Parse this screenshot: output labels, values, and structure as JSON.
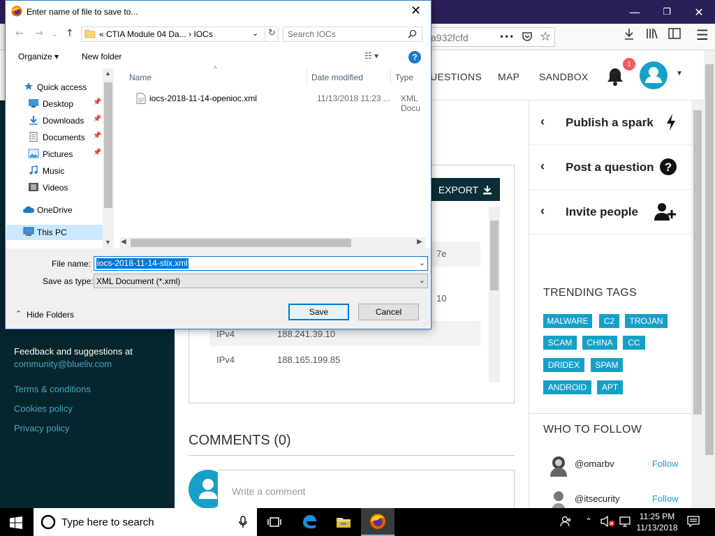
{
  "browser": {
    "url_fragment": "a932fcfd",
    "window_controls": {
      "minimize": "—",
      "restore": "❐",
      "close": "✕"
    },
    "toolbar_icons": [
      "more-dots-icon",
      "pocket-icon",
      "bookmark-star-icon",
      "download-icon",
      "library-icon",
      "sidebar-icon",
      "hamburger-menu-icon"
    ],
    "more_glyph": "•••",
    "star_glyph": "☆",
    "download_glyph": "⭳",
    "menu_glyph": "☰"
  },
  "site": {
    "nav": [
      "UESTIONS",
      "MAP",
      "SANDBOX"
    ],
    "notification_count": "1",
    "export_label": "EXPORT",
    "iocs": [
      {
        "type": "",
        "value": "7e"
      },
      {
        "type": "",
        "value": "10"
      },
      {
        "type": "IPv4",
        "value": "188.241.39.10"
      },
      {
        "type": "IPv4",
        "value": "188.165.199.85"
      }
    ],
    "comments_title": "COMMENTS (0)",
    "comment_placeholder": "Write a comment",
    "footer": {
      "feedback": "Feedback and suggestions at",
      "email": "community@blueliv.com",
      "links": [
        "Terms & conditions",
        "Cookies policy",
        "Privacy policy"
      ]
    },
    "actions": [
      {
        "label": "Publish a spark",
        "icon": "lightning-icon"
      },
      {
        "label": "Post a question",
        "icon": "question-circle-icon"
      },
      {
        "label": "Invite people",
        "icon": "add-user-icon"
      }
    ],
    "trending_title": "TRENDING TAGS",
    "tags": [
      "MALWARE",
      "C2",
      "TROJAN",
      "SCAM",
      "CHINA",
      "CC",
      "DRIDEX",
      "SPAM",
      "ANDROID",
      "APT"
    ],
    "who_to_follow_title": "WHO TO FOLLOW",
    "follow": [
      {
        "handle": "@omarbv",
        "button": "Follow"
      },
      {
        "handle": "@itsecurity",
        "button": "Follow"
      }
    ],
    "chevron": "‹"
  },
  "dialog": {
    "title": "Enter name of file to save to...",
    "address_path": "«  CTIA Module 04 Da...  ›  IOCs",
    "search_placeholder": "Search IOCs",
    "organize": "Organize ▾",
    "new_folder": "New folder",
    "help": "?",
    "nav_tree": [
      {
        "label": "Quick access",
        "icon": "star-icon",
        "pinned": false
      },
      {
        "label": "Desktop",
        "icon": "desktop-folder-icon",
        "pinned": true
      },
      {
        "label": "Downloads",
        "icon": "downloads-folder-icon",
        "pinned": true
      },
      {
        "label": "Documents",
        "icon": "documents-folder-icon",
        "pinned": true
      },
      {
        "label": "Pictures",
        "icon": "pictures-folder-icon",
        "pinned": true
      },
      {
        "label": "Music",
        "icon": "music-folder-icon",
        "pinned": false
      },
      {
        "label": "Videos",
        "icon": "videos-folder-icon",
        "pinned": false
      },
      {
        "label": "OneDrive",
        "icon": "onedrive-icon",
        "pinned": false
      },
      {
        "label": "This PC",
        "icon": "this-pc-icon",
        "pinned": false
      }
    ],
    "columns": [
      "Name",
      "Date modified",
      "Type"
    ],
    "files": [
      {
        "name": "iocs-2018-11-14-openioc.xml",
        "date": "11/13/2018 11:23 ...",
        "type": "XML Docu"
      }
    ],
    "file_name_label": "File name:",
    "file_name_value": "iocs-2018-11-14-stix.xml",
    "save_as_type_label": "Save as type:",
    "save_as_type_value": "XML Document (*.xml)",
    "hide_folders": "Hide Folders",
    "save": "Save",
    "cancel": "Cancel"
  },
  "taskbar": {
    "search_placeholder": "Type here to search",
    "time": "11:25 PM",
    "date": "11/13/2018"
  },
  "colors": {
    "accent": "#16a0c8",
    "dark_panel": "#06262e",
    "firefox_titlebar": "#2b1f59",
    "dialog_selection": "#0078d7"
  }
}
